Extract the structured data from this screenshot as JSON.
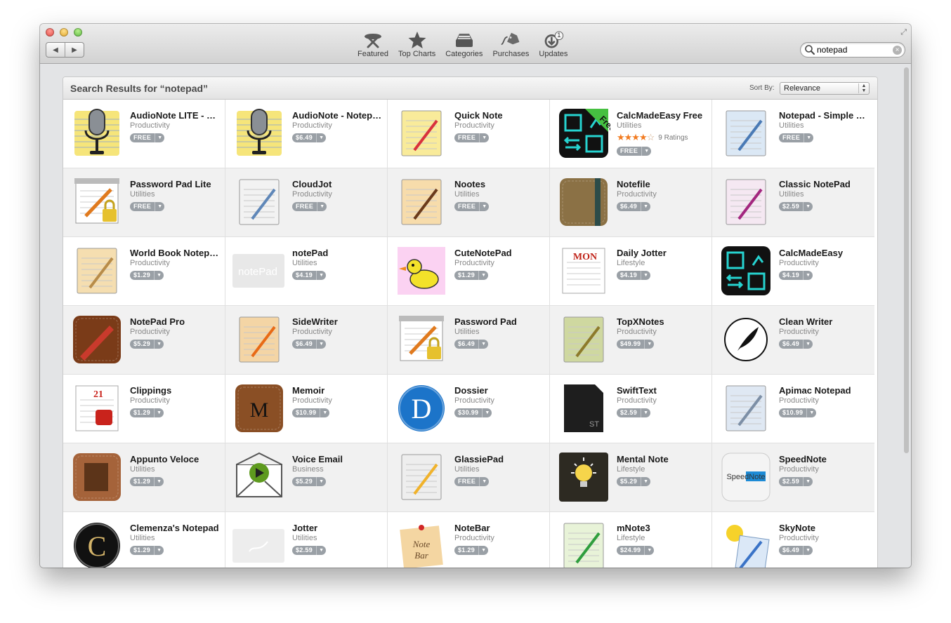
{
  "window": {
    "nav": {
      "back": "◀",
      "forward": "▶"
    },
    "fullscreen": "⤢"
  },
  "toolbar": {
    "items": [
      {
        "label": "Featured",
        "icon": "featured-icon"
      },
      {
        "label": "Top Charts",
        "icon": "star-icon"
      },
      {
        "label": "Categories",
        "icon": "categories-icon"
      },
      {
        "label": "Purchases",
        "icon": "purchases-tag-icon"
      },
      {
        "label": "Updates",
        "icon": "updates-icon",
        "badge": "1"
      }
    ]
  },
  "search": {
    "value": "notepad",
    "clear": "×"
  },
  "results": {
    "title": "Search Results for “notepad”",
    "sort_label": "Sort By:",
    "sort_value": "Relevance",
    "sort_arrows": "▲▼",
    "apps": [
      {
        "name": "AudioNote LITE - Notepad and Voice Recorder",
        "category": "Productivity",
        "price": "FREE",
        "icon": "microphone-notepad-icon",
        "colors": [
          "#f6e57a",
          "#6b7f92"
        ]
      },
      {
        "name": "AudioNote - Notepad and Voice Recorder",
        "category": "Productivity",
        "price": "$6.49",
        "icon": "microphone-notepad-icon",
        "colors": [
          "#f6e57a",
          "#6b7f92"
        ]
      },
      {
        "name": "Quick Note",
        "category": "Productivity",
        "price": "FREE",
        "icon": "yellow-notes-pencil-icon",
        "colors": [
          "#f9eb9a",
          "#d8323d"
        ]
      },
      {
        "name": "CalcMadeEasy Free",
        "category": "Utilities",
        "price": "FREE",
        "icon": "calculator-free-icon",
        "colors": [
          "#111111",
          "#26d3d0"
        ],
        "rating_stars": 4,
        "rating_text": "9 Ratings"
      },
      {
        "name": "Notepad - Simple Note",
        "category": "Utilities",
        "price": "FREE",
        "icon": "blue-paper-icon",
        "colors": [
          "#dbe8f5",
          "#4a7ab5"
        ]
      },
      {
        "name": "Password Pad Lite",
        "category": "Utilities",
        "price": "FREE",
        "icon": "notepad-lock-icon",
        "colors": [
          "#ffffff",
          "#e6c12e"
        ]
      },
      {
        "name": "CloudJot",
        "category": "Productivity",
        "price": "FREE",
        "icon": "cloud-note-icon",
        "colors": [
          "#f2f2f2",
          "#5f87b8"
        ]
      },
      {
        "name": "Nootes",
        "category": "Utilities",
        "price": "FREE",
        "icon": "paper-stack-icon",
        "colors": [
          "#f7dcab",
          "#6b3b1b"
        ]
      },
      {
        "name": "Notefile",
        "category": "Productivity",
        "price": "$6.49",
        "icon": "leather-notebook-icon",
        "colors": [
          "#8b7145",
          "#2c4c49"
        ]
      },
      {
        "name": "Classic NotePad",
        "category": "Utilities",
        "price": "$2.59",
        "icon": "spiral-pad-icon",
        "colors": [
          "#f5e8f2",
          "#a3277f"
        ]
      },
      {
        "name": "World Book Notepad",
        "category": "Productivity",
        "price": "$1.29",
        "icon": "legal-pad-icon",
        "colors": [
          "#f5deb0",
          "#b88c49"
        ]
      },
      {
        "name": "notePad",
        "category": "Utilities",
        "price": "$4.19",
        "icon": "notepad-text-icon",
        "colors": [
          "#e8e8e8",
          "#ffffff"
        ],
        "icon_text": "notePad"
      },
      {
        "name": "CuteNotePad",
        "category": "Productivity",
        "price": "$1.29",
        "icon": "duck-icon",
        "colors": [
          "#fbd2f2",
          "#f3e22a"
        ]
      },
      {
        "name": "Daily Jotter",
        "category": "Lifestyle",
        "price": "$4.19",
        "icon": "calendar-pad-icon",
        "colors": [
          "#ffffff",
          "#c0241a"
        ],
        "icon_text": "MON"
      },
      {
        "name": "CalcMadeEasy",
        "category": "Productivity",
        "price": "$4.19",
        "icon": "calculator-icon",
        "colors": [
          "#111111",
          "#26d3d0"
        ]
      },
      {
        "name": "NotePad Pro",
        "category": "Productivity",
        "price": "$5.29",
        "icon": "leather-pencil-icon",
        "colors": [
          "#7a3b18",
          "#c93a2c"
        ]
      },
      {
        "name": "SideWriter",
        "category": "Productivity",
        "price": "$6.49",
        "icon": "book-arrow-icon",
        "colors": [
          "#f4d5a5",
          "#e86a16"
        ]
      },
      {
        "name": "Password Pad",
        "category": "Utilities",
        "price": "$6.49",
        "icon": "notepad-lock-icon",
        "colors": [
          "#ffffff",
          "#e6c12e"
        ]
      },
      {
        "name": "TopXNotes",
        "category": "Productivity",
        "price": "$49.99",
        "icon": "green-paper-pencil-icon",
        "colors": [
          "#cfd8a0",
          "#8d7a2b"
        ]
      },
      {
        "name": "Clean Writer",
        "category": "Productivity",
        "price": "$6.49",
        "icon": "quill-circle-icon",
        "colors": [
          "#ffffff",
          "#111111"
        ]
      },
      {
        "name": "Clippings",
        "category": "Productivity",
        "price": "$1.29",
        "icon": "calendar-mug-icon",
        "colors": [
          "#ffffff",
          "#c9231c"
        ],
        "icon_text": "21"
      },
      {
        "name": "Memoir",
        "category": "Productivity",
        "price": "$10.99",
        "icon": "leather-wallet-icon",
        "colors": [
          "#8a4f25",
          "#f0d7a9"
        ],
        "icon_text": "M"
      },
      {
        "name": "Dossier",
        "category": "Productivity",
        "price": "$30.99",
        "icon": "blue-d-orb-icon",
        "colors": [
          "#1c74c9",
          "#ffffff"
        ],
        "icon_text": "D"
      },
      {
        "name": "SwiftText",
        "category": "Productivity",
        "price": "$2.59",
        "icon": "black-page-icon",
        "colors": [
          "#1e1e1e",
          "#9a9a9a"
        ],
        "icon_text": "ST"
      },
      {
        "name": "Apimac Notepad",
        "category": "Productivity",
        "price": "$10.99",
        "icon": "blue-spiral-pen-icon",
        "colors": [
          "#dfe8f3",
          "#7d8fa6"
        ]
      },
      {
        "name": "Appunto Veloce",
        "category": "Utilities",
        "price": "$1.29",
        "icon": "wood-note-icon",
        "colors": [
          "#a5633a",
          "#5c3419"
        ]
      },
      {
        "name": "Voice Email",
        "category": "Business",
        "price": "$5.29",
        "icon": "envelope-play-icon",
        "colors": [
          "#ffffff",
          "#5e9a1e"
        ]
      },
      {
        "name": "GlassiePad",
        "category": "Utilities",
        "price": "FREE",
        "icon": "glass-pad-pencil-icon",
        "colors": [
          "#eeeeee",
          "#f0b22b"
        ]
      },
      {
        "name": "Mental Note",
        "category": "Lifestyle",
        "price": "$5.29",
        "icon": "lightbulb-icon",
        "colors": [
          "#2d2a22",
          "#f6d54b"
        ]
      },
      {
        "name": "SpeedNote",
        "category": "Productivity",
        "price": "$2.59",
        "icon": "speednote-icon",
        "colors": [
          "#f4f4f4",
          "#1d8bd6"
        ],
        "icon_text": "SpeedNote"
      },
      {
        "name": "Clemenza's Notepad",
        "category": "Utilities",
        "price": "$1.29",
        "icon": "c-logo-icon",
        "colors": [
          "#111111",
          "#d4b46a"
        ],
        "icon_text": "C"
      },
      {
        "name": "Jotter",
        "category": "Utilities",
        "price": "$2.59",
        "icon": "pen-sign-icon",
        "colors": [
          "#ededed",
          "#ffffff"
        ]
      },
      {
        "name": "NoteBar",
        "category": "Productivity",
        "price": "$1.29",
        "icon": "sticky-note-pin-icon",
        "colors": [
          "#f4d6a2",
          "#d12727"
        ],
        "icon_text": "Note Bar"
      },
      {
        "name": "mNote3",
        "category": "Lifestyle",
        "price": "$24.99",
        "icon": "green-spiral-pad-icon",
        "colors": [
          "#e8f3d8",
          "#2f9e3e"
        ]
      },
      {
        "name": "SkyNote",
        "category": "Productivity",
        "price": "$6.49",
        "icon": "sun-notepad-icon",
        "colors": [
          "#dbe8f7",
          "#f6d22a"
        ]
      }
    ]
  }
}
